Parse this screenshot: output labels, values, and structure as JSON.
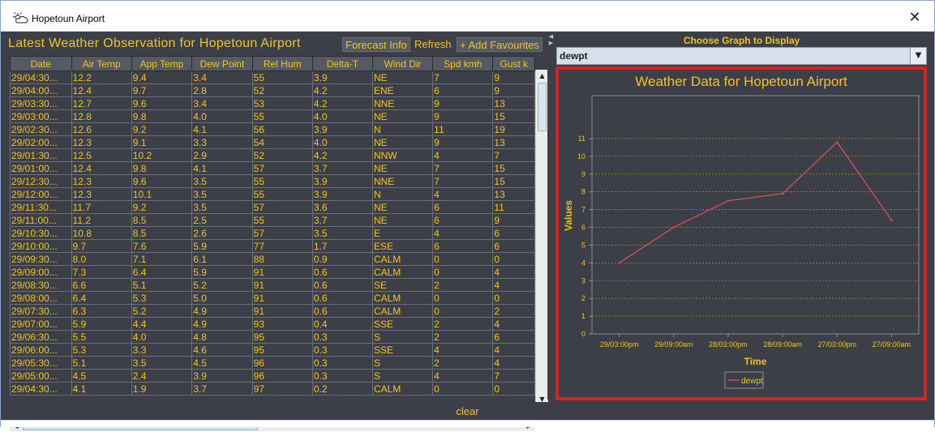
{
  "window": {
    "title": "Hopetoun Airport",
    "close_glyph": "✕",
    "icon": "cloud-sun-icon"
  },
  "observation": {
    "title": "Latest Weather Observation for Hopetoun Airport",
    "forecast_label": "Forecast Info",
    "refresh_label": "Refresh",
    "favourites_label": "+ Add Favourites"
  },
  "table": {
    "columns": [
      "Date",
      "Air Temp",
      "App Temp",
      "Dew Point",
      "Rel Hum",
      "Delta-T",
      "Wind Dir",
      "Spd kmh",
      "Gust k"
    ],
    "rows": [
      [
        "29/04:30...",
        "12.2",
        "9.4",
        "3.4",
        "55",
        "3.9",
        "NE",
        "7",
        "9"
      ],
      [
        "29/04:00...",
        "12.4",
        "9.7",
        "2.8",
        "52",
        "4.2",
        "ENE",
        "6",
        "9"
      ],
      [
        "29/03:30...",
        "12.7",
        "9.6",
        "3.4",
        "53",
        "4.2",
        "NNE",
        "9",
        "13"
      ],
      [
        "29/03:00...",
        "12.8",
        "9.8",
        "4.0",
        "55",
        "4.0",
        "NE",
        "9",
        "15"
      ],
      [
        "29/02:30...",
        "12.6",
        "9.2",
        "4.1",
        "56",
        "3.9",
        "N",
        "11",
        "19"
      ],
      [
        "29/02:00...",
        "12.3",
        "9.1",
        "3.3",
        "54",
        "4.0",
        "NE",
        "9",
        "13"
      ],
      [
        "29/01:30...",
        "12.5",
        "10.2",
        "2.9",
        "52",
        "4.2",
        "NNW",
        "4",
        "7"
      ],
      [
        "29/01:00...",
        "12.4",
        "9.8",
        "4.1",
        "57",
        "3.7",
        "NE",
        "7",
        "15"
      ],
      [
        "29/12:30...",
        "12.3",
        "9.6",
        "3.5",
        "55",
        "3.9",
        "NNE",
        "7",
        "15"
      ],
      [
        "29/12:00...",
        "12.3",
        "10.1",
        "3.5",
        "55",
        "3.9",
        "N",
        "4",
        "13"
      ],
      [
        "29/11:30...",
        "11.7",
        "9.2",
        "3.5",
        "57",
        "3.6",
        "NE",
        "6",
        "11"
      ],
      [
        "29/11:00...",
        "11.2",
        "8.5",
        "2.5",
        "55",
        "3.7",
        "NE",
        "6",
        "9"
      ],
      [
        "29/10:30...",
        "10.8",
        "8.5",
        "2.6",
        "57",
        "3.5",
        "E",
        "4",
        "6"
      ],
      [
        "29/10:00...",
        "9.7",
        "7.6",
        "5.9",
        "77",
        "1.7",
        "ESE",
        "6",
        "6"
      ],
      [
        "29/09:30...",
        "8.0",
        "7.1",
        "6.1",
        "88",
        "0.9",
        "CALM",
        "0",
        "0"
      ],
      [
        "29/09:00...",
        "7.3",
        "6.4",
        "5.9",
        "91",
        "0.6",
        "CALM",
        "0",
        "4"
      ],
      [
        "29/08:30...",
        "6.6",
        "5.1",
        "5.2",
        "91",
        "0.6",
        "SE",
        "2",
        "4"
      ],
      [
        "29/08:00...",
        "6.4",
        "5.3",
        "5.0",
        "91",
        "0.6",
        "CALM",
        "0",
        "0"
      ],
      [
        "29/07:30...",
        "6.3",
        "5.2",
        "4.9",
        "91",
        "0.6",
        "CALM",
        "0",
        "2"
      ],
      [
        "29/07:00...",
        "5.9",
        "4.4",
        "4.9",
        "93",
        "0.4",
        "SSE",
        "2",
        "4"
      ],
      [
        "29/06:30...",
        "5.5",
        "4.0",
        "4.8",
        "95",
        "0.3",
        "S",
        "2",
        "6"
      ],
      [
        "29/06:00...",
        "5.3",
        "3.3",
        "4.6",
        "95",
        "0.3",
        "SSE",
        "4",
        "4"
      ],
      [
        "29/05:30...",
        "5.1",
        "3.5",
        "4.5",
        "96",
        "0.3",
        "S",
        "2",
        "4"
      ],
      [
        "29/05:00...",
        "4.5",
        "2.4",
        "3.9",
        "96",
        "0.3",
        "S",
        "4",
        "7"
      ],
      [
        "29/04:30...",
        "4.1",
        "1.9",
        "3.7",
        "97",
        "0.2",
        "CALM",
        "0",
        "0"
      ]
    ]
  },
  "graph_panel": {
    "choose_label": "Choose Graph to Display",
    "selected": "dewpt"
  },
  "chart_data": {
    "type": "line",
    "title": "Weather Data for Hopetoun Airport",
    "xlabel": "Time",
    "ylabel": "Values",
    "categories": [
      "29/03:00pm",
      "29/09:00am",
      "28/03:00pm",
      "28/09:00am",
      "27/03:00pm",
      "27/09:00am"
    ],
    "series": [
      {
        "name": "dewpt",
        "color": "#e0525a",
        "values": [
          4.0,
          6.0,
          7.5,
          7.9,
          10.8,
          6.4
        ]
      }
    ],
    "ylim": [
      0,
      11.5
    ],
    "yticks": [
      0,
      1,
      2,
      3,
      4,
      5,
      6,
      7,
      8,
      9,
      10,
      11
    ],
    "grid": true,
    "legend": "bottom"
  },
  "bottom": {
    "clear_label": "clear"
  },
  "colors": {
    "accent": "#f2c41c",
    "panel": "#3c3f47",
    "highlight_border": "#e01f1f"
  }
}
